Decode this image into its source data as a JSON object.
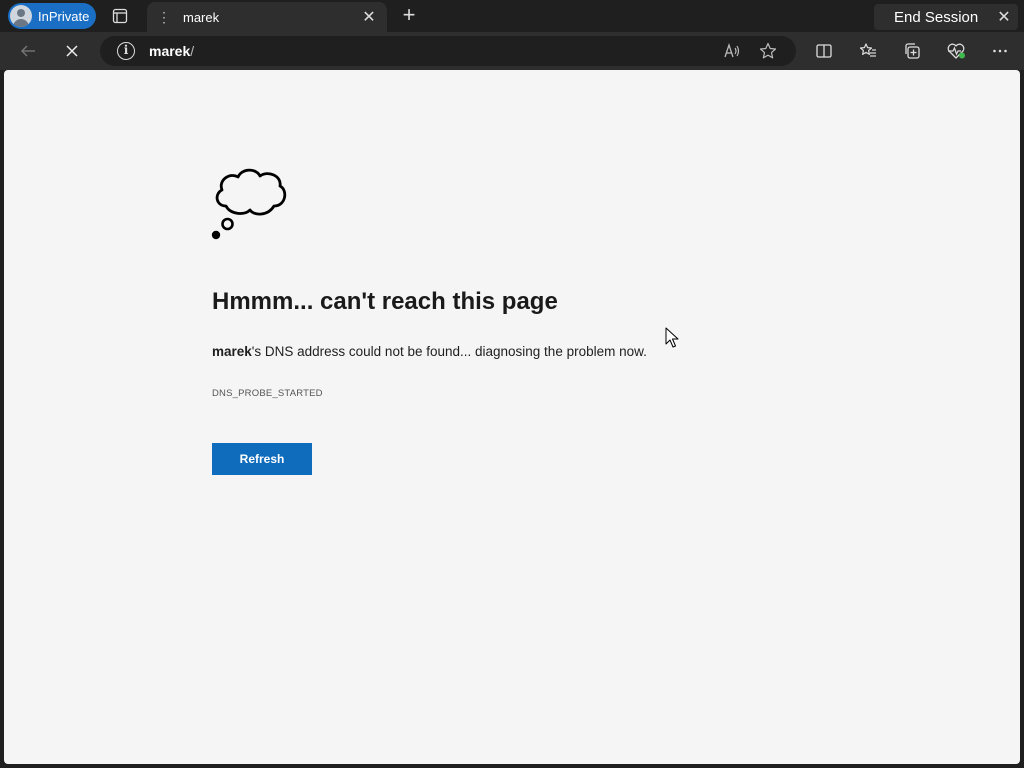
{
  "browser": {
    "inprivate_label": "InPrivate",
    "tab_title": "marek",
    "end_session_label": "End Session",
    "address": {
      "host": "marek",
      "rest": "/"
    }
  },
  "error_page": {
    "heading": "Hmmm... can't reach this page",
    "host": "marek",
    "message": "'s DNS address could not be found... diagnosing the problem now.",
    "error_code": "DNS_PROBE_STARTED",
    "refresh_label": "Refresh"
  },
  "icons": {
    "back": "back-arrow-icon",
    "stop": "stop-loading-icon",
    "info": "site-info-icon",
    "read_aloud": "read-aloud-icon",
    "favorite": "favorite-star-icon",
    "split_screen": "split-screen-icon",
    "favorites": "favorites-icon",
    "collections": "collections-icon",
    "browser_essentials": "browser-essentials-icon",
    "more": "more-menu-icon"
  },
  "colors": {
    "accent": "#0f6cbd",
    "inprivate": "#1a6fc4",
    "essentials_dot": "#3fb950"
  }
}
